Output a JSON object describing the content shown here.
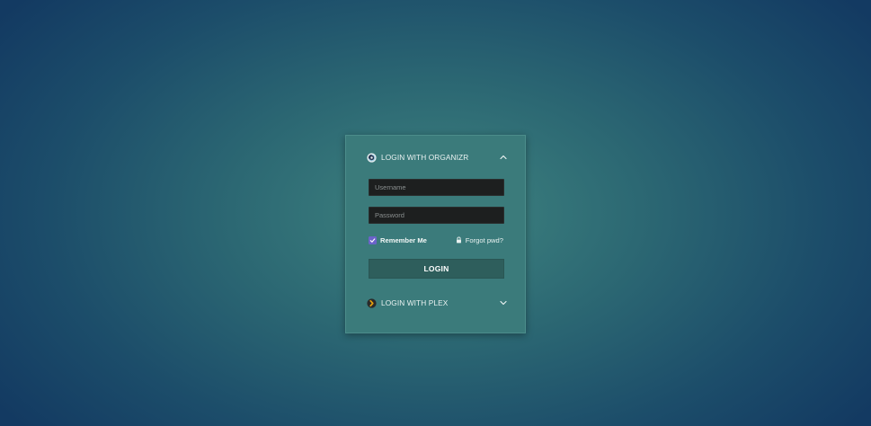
{
  "colors": {
    "card_background": "#3b7b7b",
    "input_background": "#1d1f1f",
    "button_background": "#2e5e5c",
    "checkbox_accent": "#6b63c9",
    "plex_accent": "#e5a00d"
  },
  "organizr_section": {
    "title": "LOGIN WITH ORGANIZR",
    "logo_icon": "organizr-logo-icon",
    "toggle_icon": "chevron-up-icon",
    "expanded": true
  },
  "form": {
    "username_placeholder": "Username",
    "username_value": "",
    "password_placeholder": "Password",
    "password_value": "",
    "remember_me_label": "Remember Me",
    "remember_me_checked": true,
    "forgot_label": "Forgot pwd?",
    "forgot_icon": "lock-icon",
    "login_label": "LOGIN"
  },
  "plex_section": {
    "title": "LOGIN WITH PLEX",
    "logo_icon": "plex-logo-icon",
    "toggle_icon": "chevron-down-icon",
    "expanded": false
  }
}
